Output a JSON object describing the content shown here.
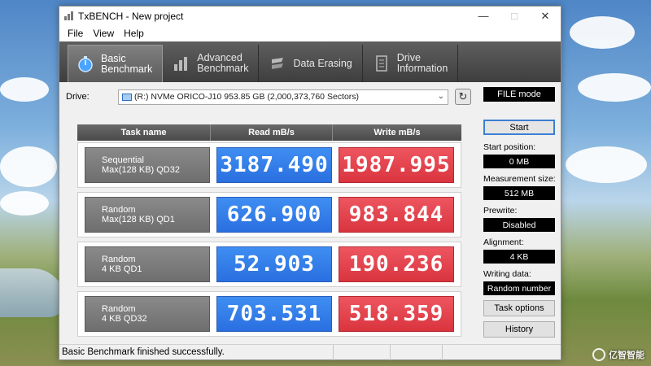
{
  "window": {
    "title": "TxBENCH - New project"
  },
  "menu": [
    "File",
    "View",
    "Help"
  ],
  "tabs": [
    {
      "label": "Basic\nBenchmark",
      "icon": "stopwatch-icon",
      "active": true
    },
    {
      "label": "Advanced\nBenchmark",
      "icon": "bar-chart-icon",
      "active": false
    },
    {
      "label": "Data Erasing",
      "icon": "eraser-icon",
      "active": false
    },
    {
      "label": "Drive\nInformation",
      "icon": "drive-info-icon",
      "active": false
    }
  ],
  "drive": {
    "label": "Drive:",
    "value": "(R:) NVMe ORICO-J10  953.85 GB (2,000,373,760 Sectors)"
  },
  "table": {
    "headers": {
      "task": "Task name",
      "read": "Read mB/s",
      "write": "Write mB/s"
    },
    "rows": [
      {
        "task": "Sequential\nMax(128 KB) QD32",
        "read": "3187.490",
        "write": "1987.995"
      },
      {
        "task": "Random\nMax(128 KB) QD1",
        "read": "626.900",
        "write": "983.844"
      },
      {
        "task": "Random\n4 KB QD1",
        "read": "52.903",
        "write": "190.236"
      },
      {
        "task": "Random\n4 KB QD32",
        "read": "703.531",
        "write": "518.359"
      }
    ]
  },
  "side": {
    "file_mode": "FILE mode",
    "start": "Start",
    "start_position_label": "Start position:",
    "start_position": "0 MB",
    "measurement_size_label": "Measurement size:",
    "measurement_size": "512 MB",
    "prewrite_label": "Prewrite:",
    "prewrite": "Disabled",
    "alignment_label": "Alignment:",
    "alignment": "4 KB",
    "writing_data_label": "Writing data:",
    "writing_data": "Random number",
    "task_options": "Task options",
    "history": "History"
  },
  "status": {
    "text": "Basic Benchmark finished successfully."
  },
  "watermark": "亿智智能",
  "colors": {
    "read": "#2f7cea",
    "write": "#e2404a",
    "toolbar": "#4a4a4a"
  }
}
